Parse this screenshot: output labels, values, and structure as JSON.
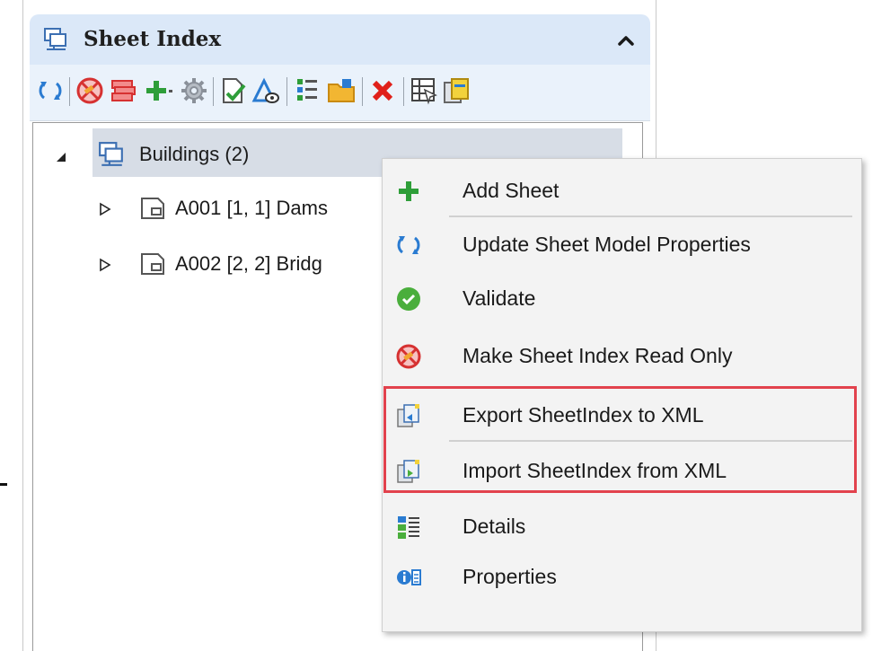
{
  "panel": {
    "title": "Sheet Index",
    "header_icon": "sheet-index-icon",
    "collapse_icon": "chevron-up-icon"
  },
  "toolbar": {
    "icons": [
      "refresh-icon",
      "read-only-icon",
      "stack-sheets-icon",
      "add-icon",
      "dropdown-arrow-icon",
      "gear-icon",
      "validate-icon",
      "properties-visible-icon",
      "tree-details-icon",
      "folder-add-icon",
      "delete-icon",
      "table-export-icon",
      "import-icon"
    ]
  },
  "tree": {
    "root": {
      "label": "Buildings (2)",
      "icon": "sheet-index-icon",
      "expanded": true
    },
    "children": [
      {
        "label": "A001 [1, 1] Dams",
        "icon": "sheet-icon"
      },
      {
        "label": "A002 [2, 2] Bridg",
        "icon": "sheet-icon"
      }
    ]
  },
  "context_menu": {
    "items": [
      {
        "label": "Add Sheet",
        "icon": "add-icon"
      },
      {
        "label": "Update Sheet Model Properties",
        "icon": "refresh-icon"
      },
      {
        "label": "Validate",
        "icon": "check-circle-icon"
      },
      {
        "label": "Make Sheet Index Read Only",
        "icon": "read-only-icon"
      },
      {
        "label": "Export SheetIndex to XML",
        "icon": "export-xml-icon"
      },
      {
        "label": "Import SheetIndex from XML",
        "icon": "import-xml-icon"
      },
      {
        "label": "Details",
        "icon": "details-icon"
      },
      {
        "label": "Properties",
        "icon": "info-icon"
      }
    ],
    "highlighted": [
      "Export SheetIndex to XML",
      "Import SheetIndex from XML"
    ]
  },
  "colors": {
    "header_bg": "#dbe8f8",
    "toolbar_bg": "#eaf2fb",
    "selection_bg": "#d7dde6",
    "menu_bg": "#f3f3f3",
    "highlight_border": "#e2424d"
  }
}
